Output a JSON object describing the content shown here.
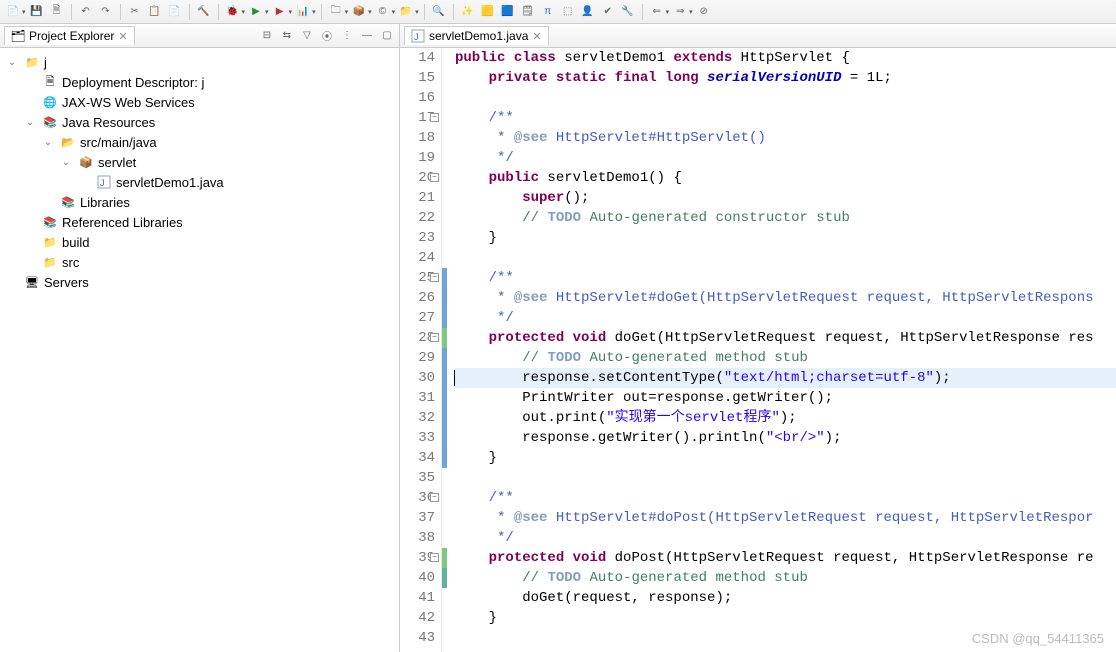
{
  "toolbar_main": [
    "new",
    "save",
    "saveall",
    "|",
    "print",
    "|",
    "undo",
    "redo",
    "|",
    "cut",
    "copy",
    "paste",
    "|",
    "build",
    "debug",
    "|",
    "run-green",
    "run-red",
    "ext",
    "|",
    "pkg",
    "pkg2",
    "down",
    "down2",
    "|",
    "tool1",
    "tool2",
    "tool3",
    "tool4",
    "|",
    "a1",
    "a2",
    "a3",
    "a4",
    "a5",
    "a6",
    "a7",
    "a8"
  ],
  "project_explorer": {
    "title": "Project Explorer",
    "tools": [
      "collapse",
      "link",
      "filter",
      "view",
      "menu"
    ],
    "root": {
      "label": "j",
      "expanded": true,
      "children": [
        {
          "label": "Deployment Descriptor: j",
          "expanded": false
        },
        {
          "label": "JAX-WS Web Services",
          "expanded": false
        },
        {
          "label": "Java Resources",
          "expanded": true,
          "children": [
            {
              "label": "src/main/java",
              "expanded": true,
              "children": [
                {
                  "label": "servlet",
                  "expanded": true,
                  "children": [
                    {
                      "label": "servletDemo1.java",
                      "expanded": false,
                      "leaf": true
                    }
                  ]
                }
              ]
            },
            {
              "label": "Libraries",
              "expanded": false
            }
          ]
        },
        {
          "label": "Referenced Libraries",
          "expanded": false
        },
        {
          "label": "build",
          "expanded": false
        },
        {
          "label": "src",
          "expanded": false
        }
      ]
    },
    "siblings": [
      {
        "label": "Servers",
        "expanded": false
      }
    ]
  },
  "editor": {
    "tab": "servletDemo1.java",
    "lines": [
      {
        "n": 14,
        "tokens": [
          {
            "t": "public ",
            "c": "kw"
          },
          {
            "t": "class ",
            "c": "kw"
          },
          {
            "t": "servletDemo1 "
          },
          {
            "t": "extends ",
            "c": "kw"
          },
          {
            "t": "HttpServlet {"
          }
        ]
      },
      {
        "n": 15,
        "tokens": [
          {
            "t": "    "
          },
          {
            "t": "private static final long ",
            "c": "kw"
          },
          {
            "t": "serialVersionUID",
            "c": "field-it"
          },
          {
            "t": " = 1L;"
          }
        ]
      },
      {
        "n": 16,
        "tokens": []
      },
      {
        "n": 17,
        "fold": "-",
        "tokens": [
          {
            "t": "    "
          },
          {
            "t": "/**",
            "c": "doc"
          }
        ]
      },
      {
        "n": 18,
        "tokens": [
          {
            "t": "     * ",
            "c": "doc"
          },
          {
            "t": "@see",
            "c": "dockey"
          },
          {
            "t": " HttpServlet#HttpServlet()",
            "c": "doc"
          }
        ]
      },
      {
        "n": 19,
        "tokens": [
          {
            "t": "     */",
            "c": "doc"
          }
        ]
      },
      {
        "n": 20,
        "fold": "-",
        "tokens": [
          {
            "t": "    "
          },
          {
            "t": "public ",
            "c": "kw"
          },
          {
            "t": "servletDemo1() {"
          }
        ]
      },
      {
        "n": 21,
        "tokens": [
          {
            "t": "        "
          },
          {
            "t": "super",
            "c": "kw"
          },
          {
            "t": "();"
          }
        ]
      },
      {
        "n": 22,
        "mark": "warn",
        "tokens": [
          {
            "t": "        "
          },
          {
            "t": "// ",
            "c": "com"
          },
          {
            "t": "TODO",
            "c": "todo"
          },
          {
            "t": " Auto-generated constructor stub",
            "c": "com"
          }
        ]
      },
      {
        "n": 23,
        "tokens": [
          {
            "t": "    }"
          }
        ]
      },
      {
        "n": 24,
        "tokens": []
      },
      {
        "n": 25,
        "fold": "-",
        "cb": "blue",
        "tokens": [
          {
            "t": "    "
          },
          {
            "t": "/**",
            "c": "doc"
          }
        ]
      },
      {
        "n": 26,
        "cb": "blue",
        "tokens": [
          {
            "t": "     * ",
            "c": "doc"
          },
          {
            "t": "@see",
            "c": "dockey"
          },
          {
            "t": " HttpServlet#doGet(HttpServletRequest request, HttpServletRespons",
            "c": "doc"
          }
        ]
      },
      {
        "n": 27,
        "cb": "blue",
        "tokens": [
          {
            "t": "     */",
            "c": "doc"
          }
        ]
      },
      {
        "n": 28,
        "fold": "-",
        "cb": "green",
        "up": true,
        "tokens": [
          {
            "t": "    "
          },
          {
            "t": "protected void ",
            "c": "kw"
          },
          {
            "t": "doGet(HttpServletRequest request, HttpServletResponse res"
          }
        ]
      },
      {
        "n": 29,
        "mark": "warn",
        "cb": "blue",
        "tokens": [
          {
            "t": "        "
          },
          {
            "t": "// ",
            "c": "com"
          },
          {
            "t": "TODO",
            "c": "todo"
          },
          {
            "t": " Auto-generated method stub",
            "c": "com"
          }
        ]
      },
      {
        "n": 30,
        "cb": "blue",
        "hl": true,
        "cursor": true,
        "tokens": [
          {
            "t": "        response.setContentType("
          },
          {
            "t": "\"text/html;charset=utf-8\"",
            "c": "str"
          },
          {
            "t": ");"
          }
        ]
      },
      {
        "n": 31,
        "cb": "blue",
        "tokens": [
          {
            "t": "        PrintWriter out=response.getWriter();"
          }
        ]
      },
      {
        "n": 32,
        "cb": "blue",
        "tokens": [
          {
            "t": "        out.print("
          },
          {
            "t": "\"实现第一个servlet程序\"",
            "c": "str"
          },
          {
            "t": ");"
          }
        ]
      },
      {
        "n": 33,
        "cb": "blue",
        "tokens": [
          {
            "t": "        response.getWriter().println("
          },
          {
            "t": "\"<br/>\"",
            "c": "str"
          },
          {
            "t": ");"
          }
        ]
      },
      {
        "n": 34,
        "cb": "blue",
        "tokens": [
          {
            "t": "    }"
          }
        ]
      },
      {
        "n": 35,
        "tokens": []
      },
      {
        "n": 36,
        "fold": "-",
        "tokens": [
          {
            "t": "    "
          },
          {
            "t": "/**",
            "c": "doc"
          }
        ]
      },
      {
        "n": 37,
        "tokens": [
          {
            "t": "     * ",
            "c": "doc"
          },
          {
            "t": "@see",
            "c": "dockey"
          },
          {
            "t": " HttpServlet#doPost(HttpServletRequest request, HttpServletRespor",
            "c": "doc"
          }
        ]
      },
      {
        "n": 38,
        "tokens": [
          {
            "t": "     */",
            "c": "doc"
          }
        ]
      },
      {
        "n": 39,
        "fold": "-",
        "up": true,
        "cb": "green",
        "tokens": [
          {
            "t": "    "
          },
          {
            "t": "protected void ",
            "c": "kw"
          },
          {
            "t": "doPost(HttpServletRequest request, HttpServletResponse re"
          }
        ]
      },
      {
        "n": 40,
        "mark": "warn",
        "cb": "teal",
        "tokens": [
          {
            "t": "        "
          },
          {
            "t": "// ",
            "c": "com"
          },
          {
            "t": "TODO",
            "c": "todo"
          },
          {
            "t": " Auto-generated method stub",
            "c": "com"
          }
        ]
      },
      {
        "n": 41,
        "tokens": [
          {
            "t": "        doGet(request, response);"
          }
        ]
      },
      {
        "n": 42,
        "tokens": [
          {
            "t": "    }"
          }
        ]
      },
      {
        "n": 43,
        "tokens": []
      }
    ]
  },
  "watermark": "CSDN @qq_54411365"
}
